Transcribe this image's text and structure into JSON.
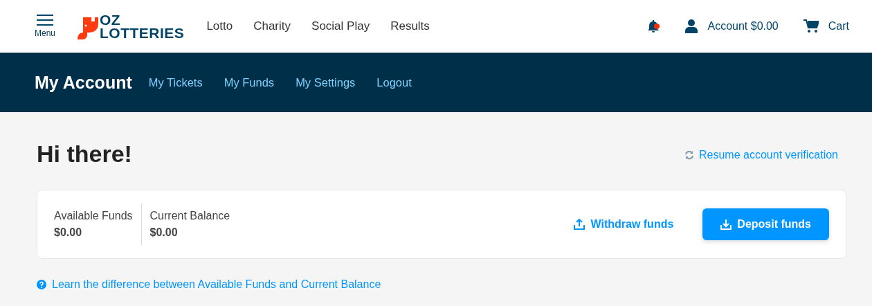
{
  "header": {
    "menu_label": "Menu",
    "logo": {
      "line_1": "OZ",
      "line_2": "LOTTERIES"
    },
    "nav": [
      {
        "label": "Lotto"
      },
      {
        "label": "Charity"
      },
      {
        "label": "Social Play"
      },
      {
        "label": "Results"
      }
    ],
    "account": "Account $0.00",
    "cart": "Cart"
  },
  "account_bar": {
    "title": "My Account",
    "links": [
      {
        "label": "My Tickets"
      },
      {
        "label": "My Funds"
      },
      {
        "label": "My Settings"
      },
      {
        "label": "Logout"
      }
    ]
  },
  "greeting": "Hi there!",
  "verification_link": "Resume account verification",
  "funds": [
    {
      "label": "Available Funds",
      "value": "$0.00"
    },
    {
      "label": "Current Balance",
      "value": "$0.00"
    }
  ],
  "withdraw_button": "Withdraw funds",
  "deposit_button": "Deposit funds",
  "help_link": "Learn the difference between Available Funds and Current Balance"
}
